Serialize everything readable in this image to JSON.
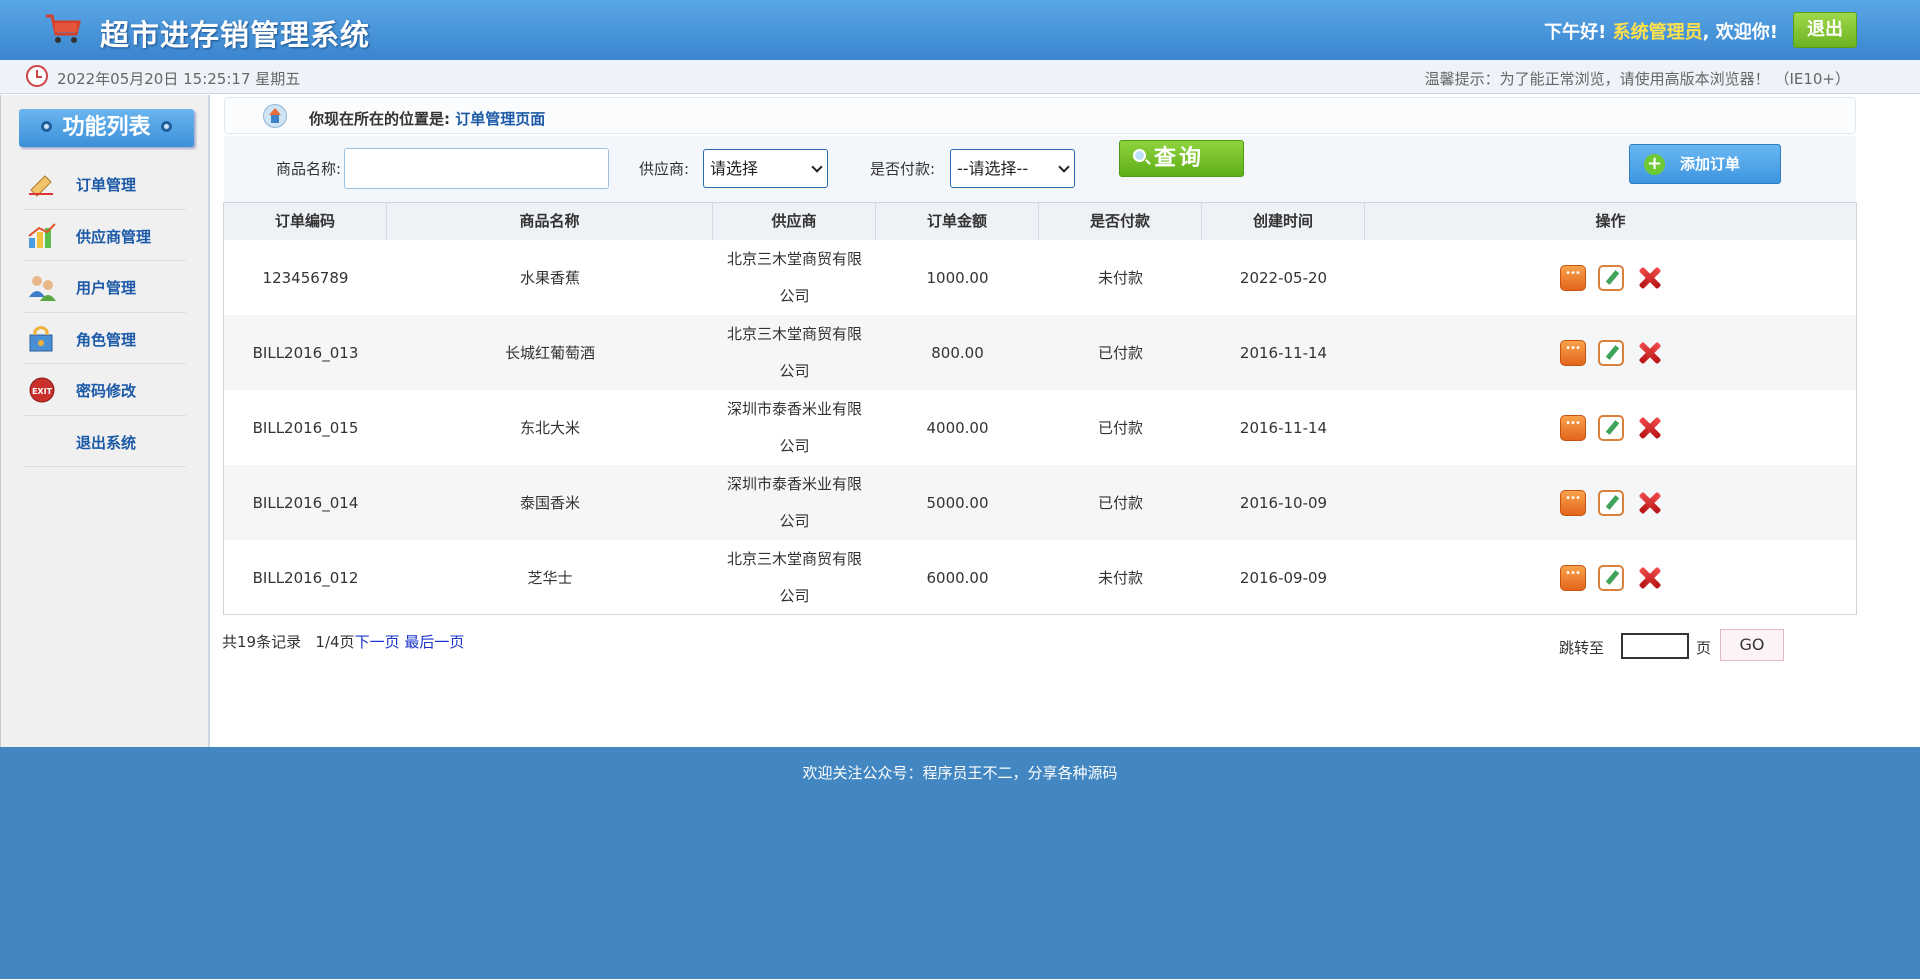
{
  "header": {
    "title": "超市进存销管理系统",
    "greeting_prefix": "下午好!",
    "role": "系统管理员",
    "greeting_suffix": ", 欢迎你!",
    "logout_label": "退出",
    "cart_icon": "cart-icon"
  },
  "timebar": {
    "datetime": "2022年05月20日 15:25:17 星期五",
    "tip": "温馨提示：为了能正常浏览，请使用高版本浏览器！ （IE10+）"
  },
  "sidebar": {
    "title": "功能列表",
    "items": [
      {
        "label": "订单管理",
        "icon": "order-icon"
      },
      {
        "label": "供应商管理",
        "icon": "supplier-icon"
      },
      {
        "label": "用户管理",
        "icon": "users-icon"
      },
      {
        "label": "角色管理",
        "icon": "role-icon"
      },
      {
        "label": "密码修改",
        "icon": "exit-icon"
      },
      {
        "label": "退出系统",
        "icon": ""
      }
    ]
  },
  "location": {
    "prefix": "你现在所在的位置是:",
    "page": "订单管理页面"
  },
  "filters": {
    "product_label": "商品名称:",
    "product_value": "",
    "supplier_label": "供应商:",
    "supplier_value": "请选择",
    "paid_label": "是否付款:",
    "paid_value": "--请选择--",
    "search_label": "查询",
    "add_label": "添加订单"
  },
  "table": {
    "headers": [
      "订单编码",
      "商品名称",
      "供应商",
      "订单金额",
      "是否付款",
      "创建时间",
      "操作"
    ],
    "rows": [
      {
        "code": "123456789",
        "product": "水果香蕉",
        "supplier": "北京三木堂商贸有限公司",
        "amount": "1000.00",
        "paid": "未付款",
        "created": "2022-05-20"
      },
      {
        "code": "BILL2016_013",
        "product": "长城红葡萄酒",
        "supplier": "北京三木堂商贸有限公司",
        "amount": "800.00",
        "paid": "已付款",
        "created": "2016-11-14"
      },
      {
        "code": "BILL2016_015",
        "product": "东北大米",
        "supplier": "深圳市泰香米业有限公司",
        "amount": "4000.00",
        "paid": "已付款",
        "created": "2016-11-14"
      },
      {
        "code": "BILL2016_014",
        "product": "泰国香米",
        "supplier": "深圳市泰香米业有限公司",
        "amount": "5000.00",
        "paid": "已付款",
        "created": "2016-10-09"
      },
      {
        "code": "BILL2016_012",
        "product": "芝华士",
        "supplier": "北京三木堂商贸有限公司",
        "amount": "6000.00",
        "paid": "未付款",
        "created": "2016-09-09"
      }
    ]
  },
  "pager": {
    "summary": "共19条记录",
    "page": "1/4页",
    "next": "下一页",
    "last": "最后一页",
    "jump_label": "跳转至",
    "jump_value": "",
    "jump_unit": "页",
    "go_label": "GO"
  },
  "footer": {
    "text": "欢迎关注公众号：程序员王不二，分享各种源码"
  },
  "colors": {
    "header_blue": "#3a85cf",
    "footer_blue": "#4287c2",
    "accent_green": "#6bb421",
    "link_blue": "#1c5aa8"
  }
}
